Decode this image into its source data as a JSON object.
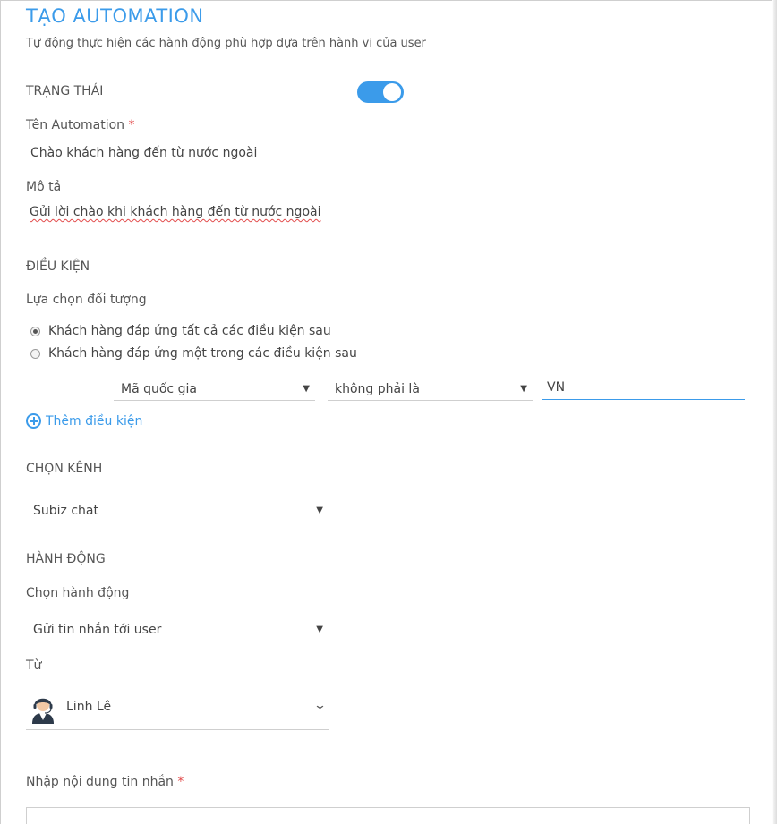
{
  "header": {
    "title": "TẠO AUTOMATION",
    "subtitle": "Tự động thực hiện các hành động phù hợp dựa trên hành vi của user"
  },
  "status": {
    "label": "TRẠNG THÁI",
    "enabled": true
  },
  "name_field": {
    "label": "Tên Automation",
    "required_mark": "*",
    "value": "Chào khách hàng đến từ nước ngoài"
  },
  "description_field": {
    "label": "Mô tả",
    "value": "Gửi lời chào khi khách hàng đến từ nước ngoài"
  },
  "conditions": {
    "section_title": "ĐIỀU KIỆN",
    "target_label": "Lựa chọn đối tượng",
    "options": [
      {
        "label": "Khách hàng đáp ứng tất cả các điều kiện sau",
        "checked": true
      },
      {
        "label": "Khách hàng đáp ứng một trong các điều kiện sau",
        "checked": false
      }
    ],
    "rule": {
      "field": "Mã quốc gia",
      "operator": "không phải là",
      "value": "VN"
    },
    "add_label": "Thêm điều kiện"
  },
  "channel": {
    "section_title": "CHỌN KÊNH",
    "selected": "Subiz chat"
  },
  "action": {
    "section_title": "HÀNH ĐỘNG",
    "choose_label": "Chọn hành động",
    "selected": "Gửi tin nhắn tới user",
    "from_label": "Từ",
    "agent_name": "Linh Lê"
  },
  "message": {
    "label": "Nhập nội dung tin nhắn",
    "required_mark": "*"
  },
  "icons": {
    "caret": "caret-down-icon",
    "chevron": "chevron-down-icon",
    "plus": "plus-circle-icon",
    "avatar": "agent-avatar-icon"
  },
  "colors": {
    "accent": "#3b9bea",
    "required": "#e24b4b"
  }
}
